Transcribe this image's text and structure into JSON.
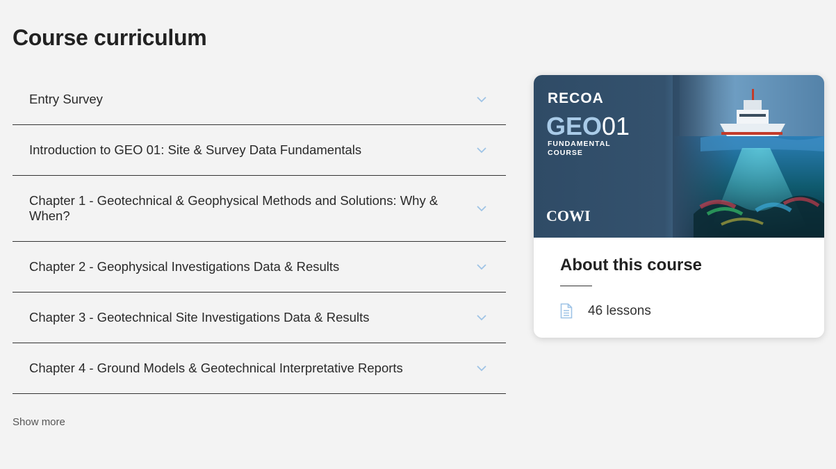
{
  "page": {
    "title": "Course curriculum"
  },
  "curriculum": {
    "sections": [
      {
        "label": "Entry Survey"
      },
      {
        "label": "Introduction to GEO 01: Site & Survey Data Fundamentals"
      },
      {
        "label": "Chapter 1 - Geotechnical & Geophysical Methods and Solutions: Why & When?"
      },
      {
        "label": "Chapter 2 - Geophysical Investigations Data & Results"
      },
      {
        "label": "Chapter 3 - Geotechnical Site Investigations Data & Results"
      },
      {
        "label": "Chapter 4 - Ground Models & Geotechnical Interpretative Reports"
      }
    ],
    "show_more": "Show more"
  },
  "card": {
    "banner": {
      "brand": "RECOA",
      "course_code_a": "GEO",
      "course_code_b": "01",
      "subtitle_line1": "FUNDAMENTAL",
      "subtitle_line2": "COURSE",
      "partner": "COWI"
    },
    "about_title": "About this course",
    "lessons": "46 lessons"
  },
  "colors": {
    "background": "#f3f3f3",
    "chevron": "#9ec3e6",
    "banner_bg": "#2f4b66",
    "code_accent": "#a9cbe8"
  },
  "icons": {
    "section_toggle": "chevron-down-icon",
    "lessons": "document-icon"
  }
}
